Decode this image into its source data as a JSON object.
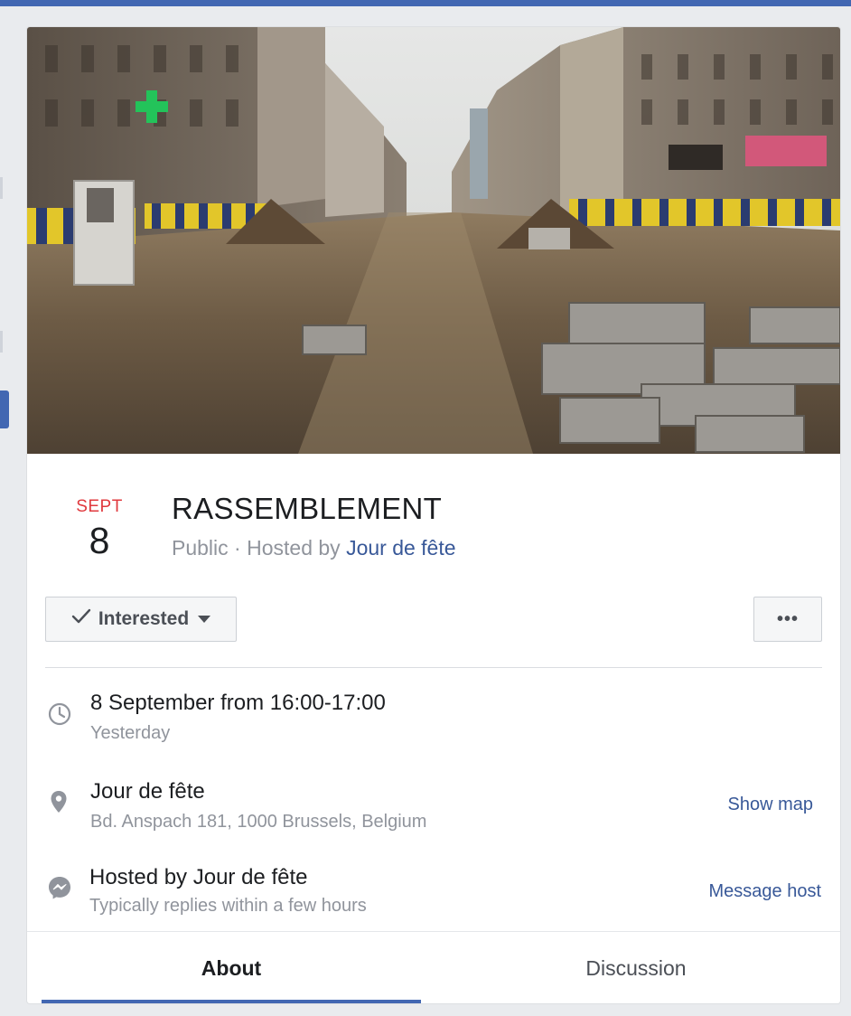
{
  "event": {
    "date_month": "SEPT",
    "date_day": "8",
    "title": "RASSEMBLEMENT",
    "privacy": "Public",
    "separator": "·",
    "hosted_by_prefix": "Hosted by",
    "host_name": "Jour de fête"
  },
  "actions": {
    "interested_label": "Interested",
    "more_label": "•••"
  },
  "details": {
    "time": {
      "icon": "clock-icon",
      "main": "8 September from 16:00-17:00",
      "sub": "Yesterday"
    },
    "place": {
      "icon": "location-pin-icon",
      "main": "Jour de fête",
      "sub": "Bd. Anspach 181, 1000 Brussels, Belgium",
      "action": "Show map"
    },
    "host": {
      "icon": "messenger-icon",
      "main": "Hosted by Jour de fête",
      "sub": "Typically replies within a few hours",
      "action": "Message host"
    }
  },
  "tabs": [
    {
      "label": "About",
      "active": true
    },
    {
      "label": "Discussion",
      "active": false
    }
  ],
  "colors": {
    "accent": "#4267b2",
    "link": "#385898",
    "date_month": "#e0393e",
    "page_bg": "#e9ebee"
  }
}
